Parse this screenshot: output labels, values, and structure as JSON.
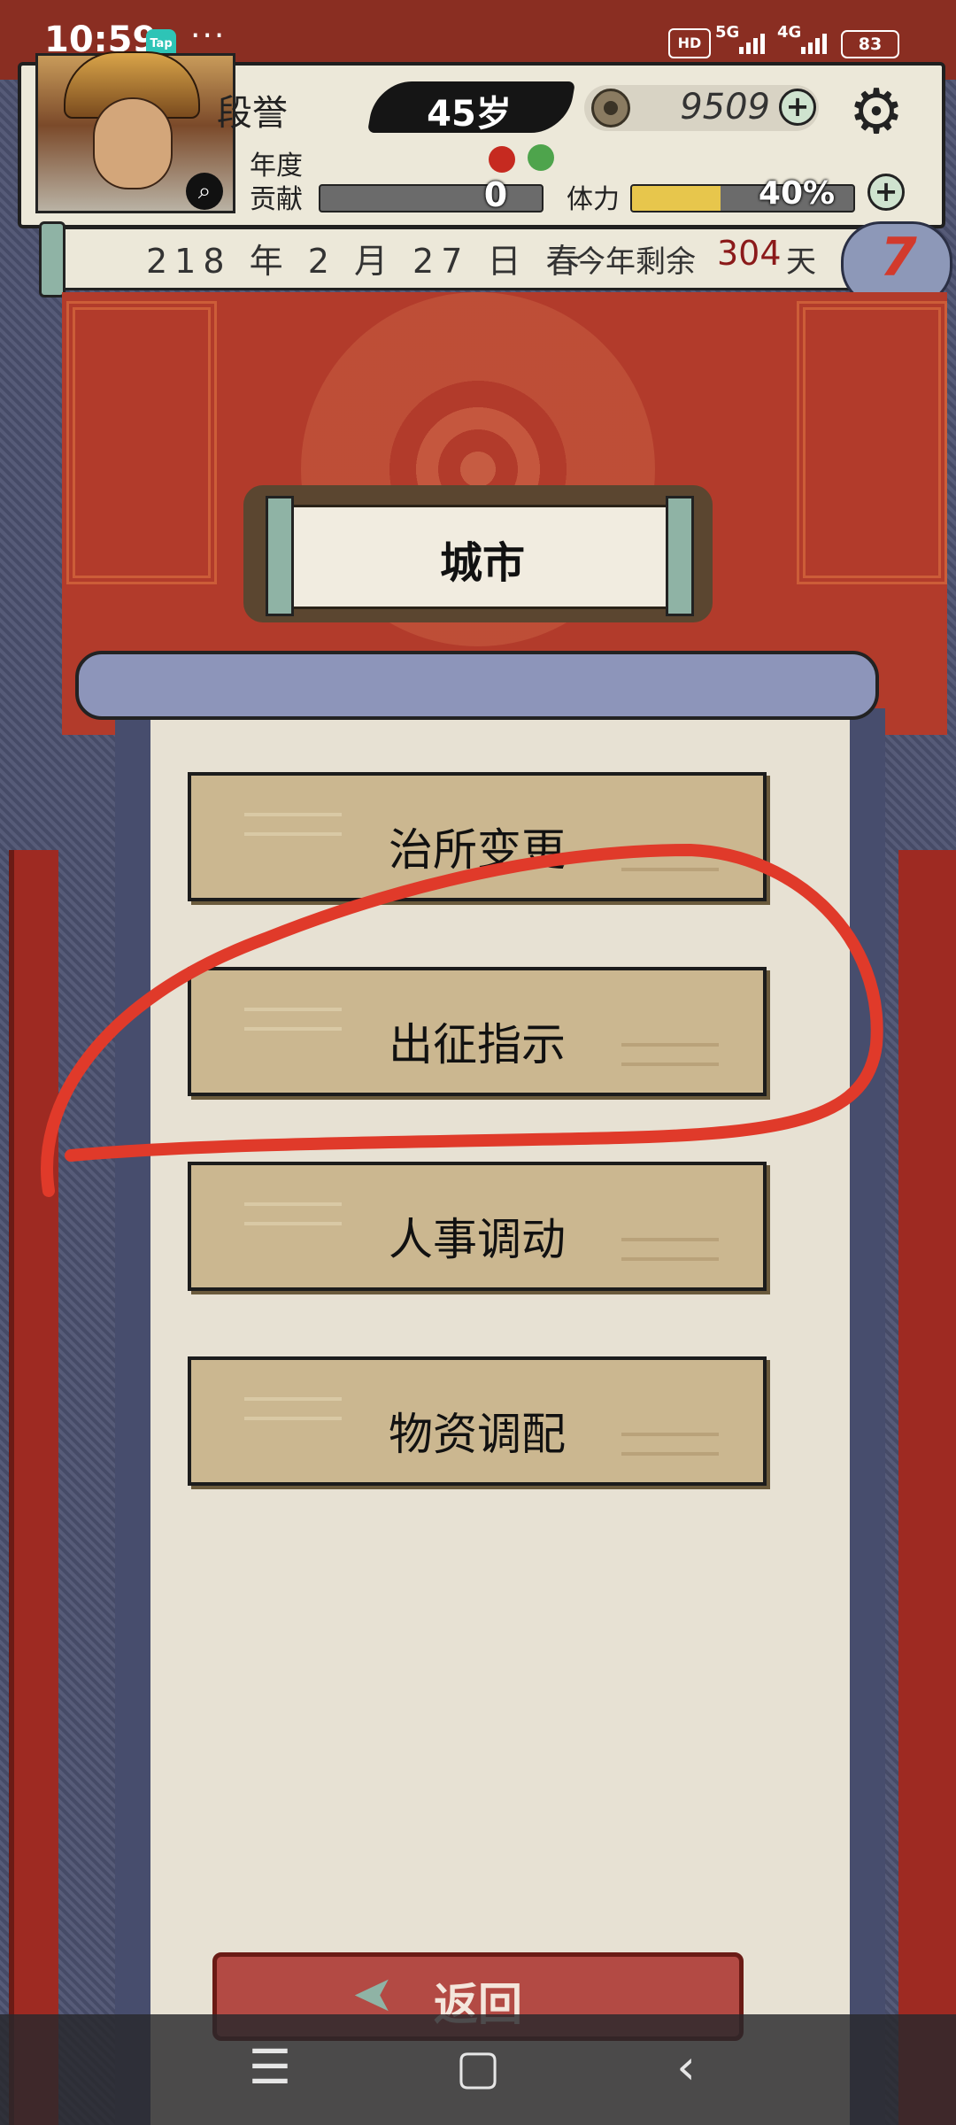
{
  "status_bar": {
    "time": "10:59",
    "app_badge": "Tap",
    "more": "···",
    "hd": "HD",
    "signal_5g": "5G",
    "signal_4g": "4G",
    "battery": "83"
  },
  "player": {
    "name": "段誉",
    "age": "45岁",
    "coins": "9509",
    "contribution_label_line1": "年度",
    "contribution_label_line2": "贡献",
    "contribution_value": "0",
    "stamina_label": "体力",
    "stamina_value": "40%",
    "stamina_fraction": 0.4
  },
  "date_bar": {
    "date": "218 年 2 月 27 日 春",
    "remain_label": "今年剩余",
    "remain_value": "304",
    "remain_unit": "天",
    "badge_number": "7"
  },
  "page": {
    "title": "城市"
  },
  "menu": {
    "items": [
      {
        "label": "治所变更"
      },
      {
        "label": "出征指示"
      },
      {
        "label": "人事调动"
      },
      {
        "label": "物资调配"
      }
    ]
  },
  "back": {
    "label": "返回"
  },
  "nav": {
    "menu": "☰",
    "home": "▢",
    "back": "‹"
  },
  "colors": {
    "banner_red": "#b23b2b",
    "button_tan": "#cbb790",
    "annotation_red": "#e03a2a",
    "stamina_yellow": "#e7c64c"
  },
  "icons": [
    "magnifier-icon",
    "coin-icon",
    "plus-icon",
    "gear-icon",
    "back-arrow-icon"
  ]
}
